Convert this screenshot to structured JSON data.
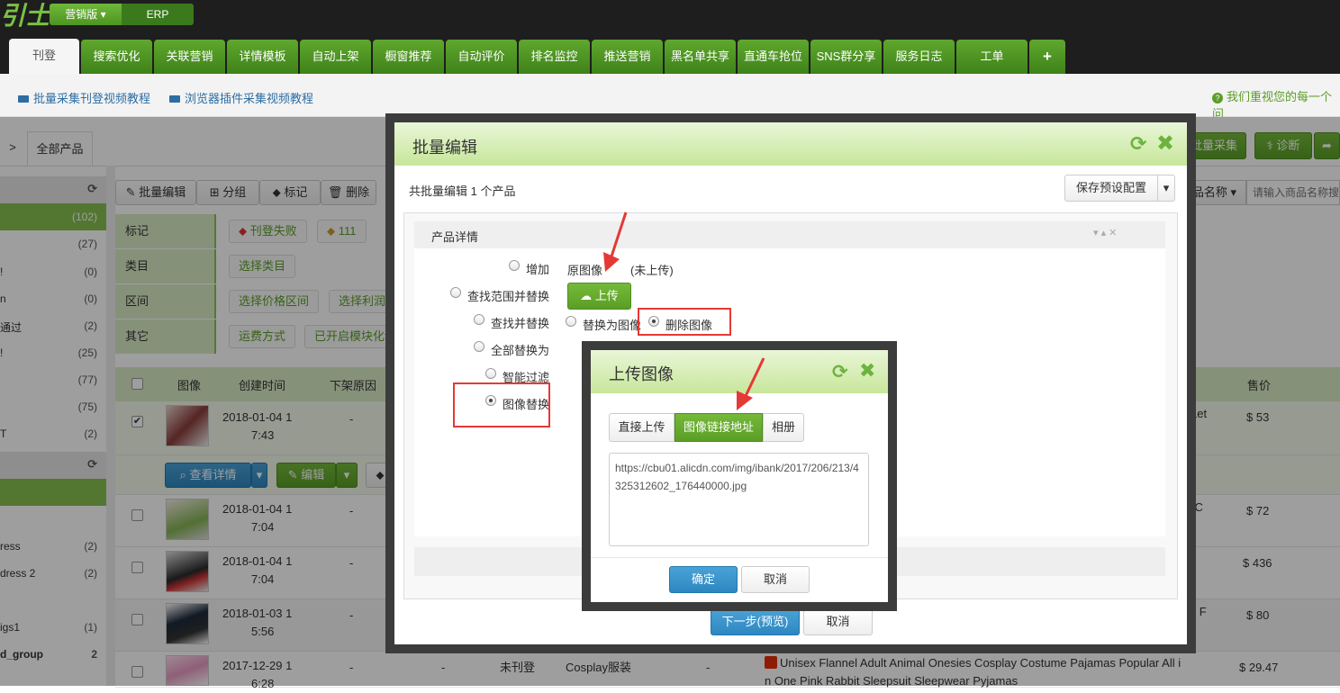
{
  "header": {
    "logo": "引士",
    "edition_label": "营销版",
    "erp_label": "ERP"
  },
  "tabs": [
    "刊登",
    "搜索优化",
    "关联营销",
    "详情模板",
    "自动上架",
    "橱窗推荐",
    "自动评价",
    "排名监控",
    "推送营销",
    "黑名单共享",
    "直通车抢位",
    "SNS群分享",
    "服务日志",
    "工单",
    "+"
  ],
  "links": {
    "batch_video": "批量采集刊登视频教程",
    "plugin_video": "浏览器插件采集视频教程",
    "notice": "我们重视您的每一个问"
  },
  "breadcrumb": {
    "arrow": ">",
    "all_products": "全部产品"
  },
  "sidebar": {
    "counts": [
      {
        "label": "",
        "count": "(102)"
      },
      {
        "label": "",
        "count": "(27)"
      },
      {
        "label": "!",
        "count": "(0)"
      },
      {
        "label": "n",
        "count": "(0)"
      },
      {
        "label": "通过",
        "count": "(2)"
      },
      {
        "label": "!",
        "count": "(25)"
      },
      {
        "label": "",
        "count": "(77)"
      },
      {
        "label": "",
        "count": "(75)"
      },
      {
        "label": "T",
        "count": "(2)"
      }
    ],
    "groups": [
      {
        "label": "ress",
        "count": "(2)"
      },
      {
        "label": "dress 2",
        "count": "(2)"
      },
      {
        "label": "igs1",
        "count": "(1)"
      },
      {
        "label": "d_group",
        "count": "2"
      }
    ]
  },
  "toolbar": {
    "batch_edit": "批量编辑",
    "group": "分组",
    "mark": "标记",
    "delete": "删除",
    "batch_collect": "批量采集",
    "diagnose": "诊断",
    "search_field": "商品名称",
    "search_placeholder": "请输入商品名称搜"
  },
  "filters": {
    "mark_label": "标记",
    "mark_tags": [
      "刊登失败",
      "111"
    ],
    "category_label": "类目",
    "category_select": "选择类目",
    "range_label": "区间",
    "range_price": "选择价格区间",
    "range_profit": "选择利润区",
    "other_label": "其它",
    "other_shipping": "运费方式",
    "other_module": "已开启模块化详"
  },
  "table": {
    "headers": {
      "image": "图像",
      "created": "创建时间",
      "reason": "下架原因",
      "price": "售价"
    },
    "rows": [
      {
        "date": "2018-01-04 1",
        "time": "7:43",
        "reason": "-",
        "title_tail": "Let",
        "price": "$ 53"
      },
      {
        "date": "2018-01-04 1",
        "time": "7:04",
        "reason": "-",
        "title_tail": "m C",
        "price": "$ 72"
      },
      {
        "date": "2018-01-04 1",
        "time": "7:04",
        "reason": "-",
        "title_tail": "",
        "price": "$ 436"
      },
      {
        "date": "2018-01-03 1",
        "time": "5:56",
        "reason": "-",
        "title_tail": "le F",
        "price": "$ 80"
      },
      {
        "date": "2017-12-29 1",
        "time": "6:28",
        "reason": "-",
        "reason2": "-",
        "status": "未刊登",
        "category": "Cosplay服装",
        "dash": "-",
        "title": "Unisex  Flannel Adult Animal Onesies Cosplay Costume Pajamas Popular All i",
        "title2": "n One Pink Rabbit Sleepsuit Sleepwear Pyjamas",
        "price": "$ 29.47"
      }
    ],
    "detail_button": "查看详情",
    "edit_button": "编辑"
  },
  "batch_modal": {
    "title": "批量编辑",
    "summary": "共批量编辑 1 个产品",
    "save_preset": "保存预设配置",
    "section_title": "产品详情",
    "options": {
      "add": "增加",
      "find_range_replace": "查找范围并替换",
      "find_replace": "查找并替换",
      "replace_all": "全部替换为",
      "smart_filter": "智能过滤",
      "image_replace": "图像替换"
    },
    "original_image": "原图像",
    "not_uploaded": "(未上传)",
    "upload_button": "上传",
    "replace_with_image": "替换为图像",
    "delete_image": "删除图像",
    "next_button": "下一步(预览)",
    "cancel_button": "取消"
  },
  "upload_modal": {
    "title": "上传图像",
    "tabs": [
      "直接上传",
      "图像链接地址",
      "相册"
    ],
    "url_value": "https://cbu01.alicdn.com/img/ibank/2017/206/213/4325312602_176440000.jpg",
    "confirm": "确定",
    "cancel": "取消"
  },
  "colors": {
    "green": "#5a9e26",
    "annotation_red": "#e53935",
    "modal_border": "#3c3c3c"
  }
}
